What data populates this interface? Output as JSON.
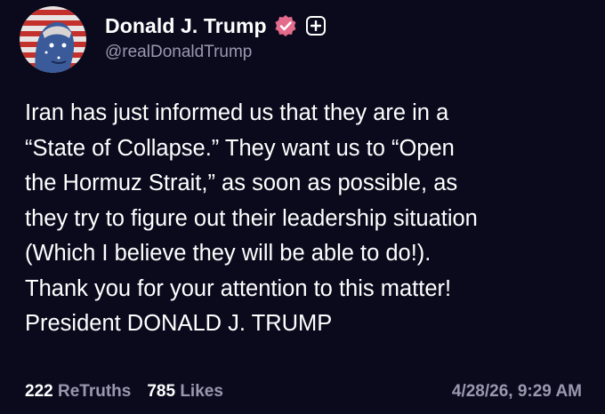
{
  "colors": {
    "background": "#0b0a1d",
    "text": "#ffffff",
    "muted": "#9a98ae",
    "verified_badge": "#e36b8b"
  },
  "author": {
    "display_name": "Donald J. Trump",
    "handle": "@realDonaldTrump",
    "avatar_icon": "avatar-portrait",
    "verified_icon": "verified-badge-icon",
    "follow_icon": "plus-icon"
  },
  "post": {
    "text": "Iran has just informed us that they are in a\n“State of Collapse.” They want us to “Open\nthe Hormuz Strait,” as soon as possible, as\nthey try to figure out their leadership situation\n(Which I believe they will be able to do!).\nThank you for your attention to this matter!\nPresident DONALD J. TRUMP"
  },
  "stats": {
    "retruths_count": "222",
    "retruths_label": "ReTruths",
    "likes_count": "785",
    "likes_label": "Likes"
  },
  "timestamp": "4/28/26, 9:29 AM"
}
